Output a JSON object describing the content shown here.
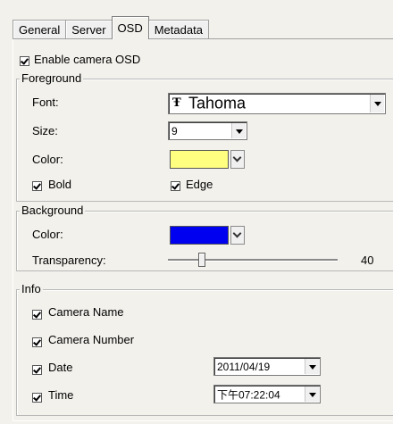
{
  "tabs": [
    {
      "label": "General"
    },
    {
      "label": "Server"
    },
    {
      "label": "OSD"
    },
    {
      "label": "Metadata"
    }
  ],
  "enable_osd": {
    "label": "Enable camera OSD",
    "checked": true
  },
  "foreground": {
    "title": "Foreground",
    "font_label": "Font:",
    "font_value": "Tahoma",
    "font_icon": "truetype-font-icon",
    "size_label": "Size:",
    "size_value": "9",
    "color_label": "Color:",
    "color": "#ffff80",
    "bold_label": "Bold",
    "bold_checked": true,
    "edge_label": "Edge",
    "edge_checked": true
  },
  "background": {
    "title": "Background",
    "color_label": "Color:",
    "color": "#0000f0",
    "transparency_label": "Transparency:",
    "transparency_value": "40",
    "transparency_fraction": 0.2
  },
  "info": {
    "title": "Info",
    "camera_name_label": "Camera Name",
    "camera_number_label": "Camera Number",
    "date_label": "Date",
    "date_value": "2011/04/19",
    "time_label": "Time",
    "time_value": "下午07:22:04"
  }
}
